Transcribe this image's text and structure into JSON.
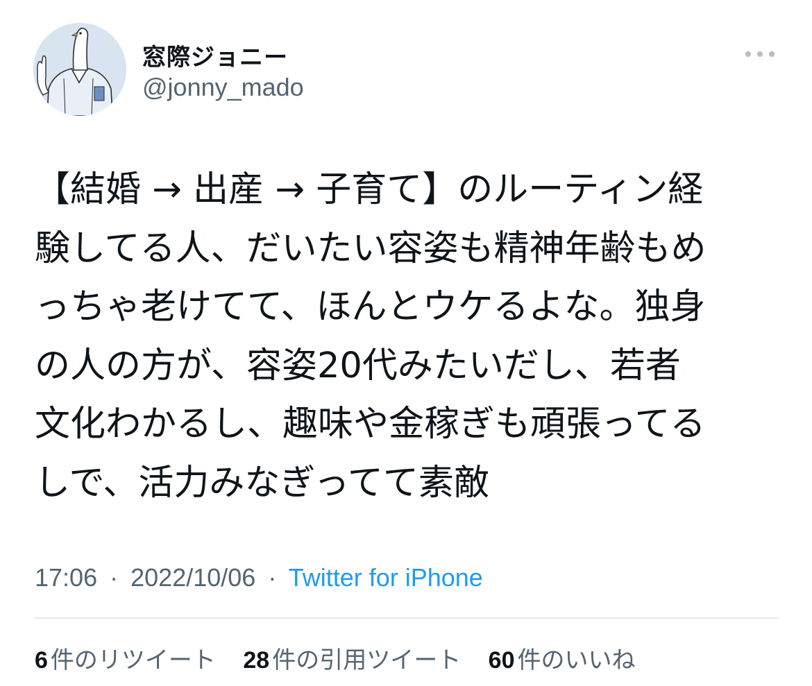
{
  "user": {
    "display_name": "窓際ジョニー",
    "handle": "@jonny_mado",
    "avatar_icon": "pigeon-avatar-icon"
  },
  "menu": {
    "icon": "more-dots-icon"
  },
  "tweet": {
    "lines": [
      "【結婚 → 出産 → 子育て】のルーティン経",
      "験してる人、だいたい容姿も精神年齢もめ",
      "っちゃ老けてて、ほんとウケるよな。独身",
      "の人の方が、容姿20代みたいだし、若者",
      "文化わかるし、趣味や金稼ぎも頑張ってる",
      "しで、活力みなぎってて素敵"
    ]
  },
  "meta": {
    "time": "17:06",
    "separator": "·",
    "date": "2022/10/06",
    "source": "Twitter for iPhone"
  },
  "stats": {
    "retweets_count": "6",
    "retweets_label": "件のリツイート",
    "quotes_count": "28",
    "quotes_label": "件の引用ツイート",
    "likes_count": "60",
    "likes_label": "件のいいね"
  },
  "colors": {
    "text_primary": "#0f1419",
    "text_secondary": "#536471",
    "link": "#1d9bf0",
    "divider": "#e6e9eb"
  }
}
